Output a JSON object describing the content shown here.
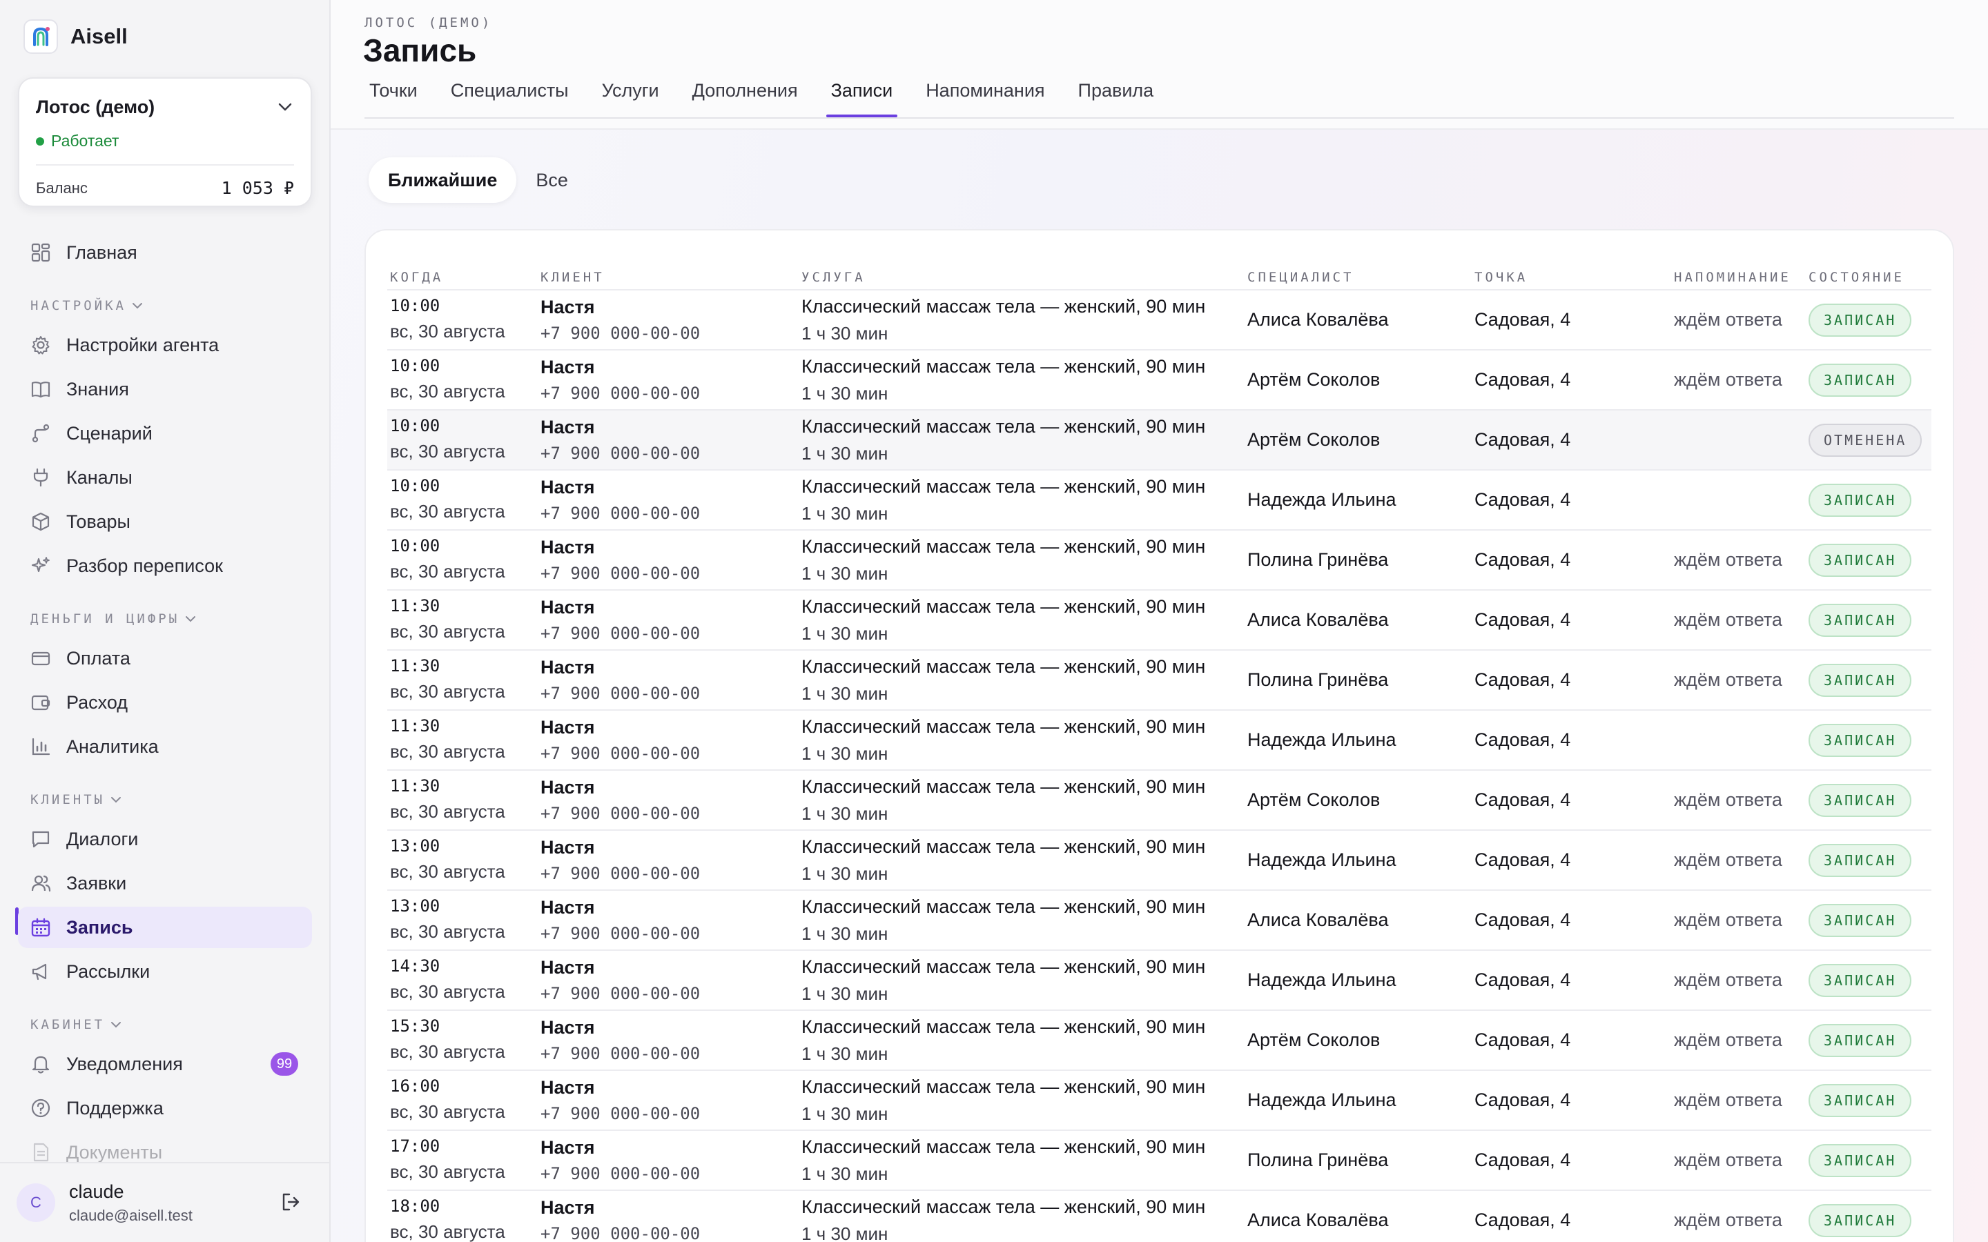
{
  "brand": {
    "name": "Aisell"
  },
  "org": {
    "name": "Лотос (демо)",
    "status": "Работает",
    "balance_label": "Баланс",
    "balance_value": "1 053 ₽"
  },
  "nav": {
    "home": "Главная",
    "section_settings": "НАСТРОЙКА",
    "agent_settings": "Настройки агента",
    "knowledge": "Знания",
    "scenario": "Сценарий",
    "channels": "Каналы",
    "products": "Товары",
    "chat_review": "Разбор переписок",
    "section_money": "ДЕНЬГИ И ЦИФРЫ",
    "payment": "Оплата",
    "expense": "Расход",
    "analytics": "Аналитика",
    "section_clients": "КЛИЕНТЫ",
    "dialogs": "Диалоги",
    "requests": "Заявки",
    "booking": "Запись",
    "mailings": "Рассылки",
    "section_cabinet": "КАБИНЕТ",
    "notifications": "Уведомления",
    "notifications_count": "99",
    "support": "Поддержка",
    "documents": "Документы"
  },
  "user": {
    "initial": "C",
    "name": "claude",
    "email": "claude@aisell.test"
  },
  "header": {
    "kicker": "ЛОТОС (ДЕМО)",
    "title": "Запись",
    "tabs": [
      "Точки",
      "Специалисты",
      "Услуги",
      "Дополнения",
      "Записи",
      "Напоминания",
      "Правила"
    ],
    "active_tab": "Записи"
  },
  "filter": {
    "nearest": "Ближайшие",
    "all": "Все"
  },
  "table": {
    "columns": [
      "КОГДА",
      "КЛИЕНТ",
      "УСЛУГА",
      "СПЕЦИАЛИСТ",
      "ТОЧКА",
      "НАПОМИНАНИЕ",
      "СОСТОЯНИЕ"
    ],
    "rows": [
      {
        "time": "10:00",
        "date": "вс, 30 августа",
        "client": "Настя",
        "phone": "+7 900 000-00-00",
        "service": "Классический массаж тела — женский, 90 мин",
        "duration": "1 ч 30 мин",
        "specialist": "Алиса Ковалёва",
        "location": "Садовая, 4",
        "reminder": "ждём ответа",
        "status": "ЗАПИСАН"
      },
      {
        "time": "10:00",
        "date": "вс, 30 августа",
        "client": "Настя",
        "phone": "+7 900 000-00-00",
        "service": "Классический массаж тела — женский, 90 мин",
        "duration": "1 ч 30 мин",
        "specialist": "Артём Соколов",
        "location": "Садовая, 4",
        "reminder": "ждём ответа",
        "status": "ЗАПИСАН"
      },
      {
        "time": "10:00",
        "date": "вс, 30 августа",
        "client": "Настя",
        "phone": "+7 900 000-00-00",
        "service": "Классический массаж тела — женский, 90 мин",
        "duration": "1 ч 30 мин",
        "specialist": "Артём Соколов",
        "location": "Садовая, 4",
        "reminder": "",
        "status": "ОТМЕНЕНА"
      },
      {
        "time": "10:00",
        "date": "вс, 30 августа",
        "client": "Настя",
        "phone": "+7 900 000-00-00",
        "service": "Классический массаж тела — женский, 90 мин",
        "duration": "1 ч 30 мин",
        "specialist": "Надежда Ильина",
        "location": "Садовая, 4",
        "reminder": "",
        "status": "ЗАПИСАН"
      },
      {
        "time": "10:00",
        "date": "вс, 30 августа",
        "client": "Настя",
        "phone": "+7 900 000-00-00",
        "service": "Классический массаж тела — женский, 90 мин",
        "duration": "1 ч 30 мин",
        "specialist": "Полина Гринёва",
        "location": "Садовая, 4",
        "reminder": "ждём ответа",
        "status": "ЗАПИСАН"
      },
      {
        "time": "11:30",
        "date": "вс, 30 августа",
        "client": "Настя",
        "phone": "+7 900 000-00-00",
        "service": "Классический массаж тела — женский, 90 мин",
        "duration": "1 ч 30 мин",
        "specialist": "Алиса Ковалёва",
        "location": "Садовая, 4",
        "reminder": "ждём ответа",
        "status": "ЗАПИСАН"
      },
      {
        "time": "11:30",
        "date": "вс, 30 августа",
        "client": "Настя",
        "phone": "+7 900 000-00-00",
        "service": "Классический массаж тела — женский, 90 мин",
        "duration": "1 ч 30 мин",
        "specialist": "Полина Гринёва",
        "location": "Садовая, 4",
        "reminder": "ждём ответа",
        "status": "ЗАПИСАН"
      },
      {
        "time": "11:30",
        "date": "вс, 30 августа",
        "client": "Настя",
        "phone": "+7 900 000-00-00",
        "service": "Классический массаж тела — женский, 90 мин",
        "duration": "1 ч 30 мин",
        "specialist": "Надежда Ильина",
        "location": "Садовая, 4",
        "reminder": "",
        "status": "ЗАПИСАН"
      },
      {
        "time": "11:30",
        "date": "вс, 30 августа",
        "client": "Настя",
        "phone": "+7 900 000-00-00",
        "service": "Классический массаж тела — женский, 90 мин",
        "duration": "1 ч 30 мин",
        "specialist": "Артём Соколов",
        "location": "Садовая, 4",
        "reminder": "ждём ответа",
        "status": "ЗАПИСАН"
      },
      {
        "time": "13:00",
        "date": "вс, 30 августа",
        "client": "Настя",
        "phone": "+7 900 000-00-00",
        "service": "Классический массаж тела — женский, 90 мин",
        "duration": "1 ч 30 мин",
        "specialist": "Надежда Ильина",
        "location": "Садовая, 4",
        "reminder": "ждём ответа",
        "status": "ЗАПИСАН"
      },
      {
        "time": "13:00",
        "date": "вс, 30 августа",
        "client": "Настя",
        "phone": "+7 900 000-00-00",
        "service": "Классический массаж тела — женский, 90 мин",
        "duration": "1 ч 30 мин",
        "specialist": "Алиса Ковалёва",
        "location": "Садовая, 4",
        "reminder": "ждём ответа",
        "status": "ЗАПИСАН"
      },
      {
        "time": "14:30",
        "date": "вс, 30 августа",
        "client": "Настя",
        "phone": "+7 900 000-00-00",
        "service": "Классический массаж тела — женский, 90 мин",
        "duration": "1 ч 30 мин",
        "specialist": "Надежда Ильина",
        "location": "Садовая, 4",
        "reminder": "ждём ответа",
        "status": "ЗАПИСАН"
      },
      {
        "time": "15:30",
        "date": "вс, 30 августа",
        "client": "Настя",
        "phone": "+7 900 000-00-00",
        "service": "Классический массаж тела — женский, 90 мин",
        "duration": "1 ч 30 мин",
        "specialist": "Артём Соколов",
        "location": "Садовая, 4",
        "reminder": "ждём ответа",
        "status": "ЗАПИСАН"
      },
      {
        "time": "16:00",
        "date": "вс, 30 августа",
        "client": "Настя",
        "phone": "+7 900 000-00-00",
        "service": "Классический массаж тела — женский, 90 мин",
        "duration": "1 ч 30 мин",
        "specialist": "Надежда Ильина",
        "location": "Садовая, 4",
        "reminder": "ждём ответа",
        "status": "ЗАПИСАН"
      },
      {
        "time": "17:00",
        "date": "вс, 30 августа",
        "client": "Настя",
        "phone": "+7 900 000-00-00",
        "service": "Классический массаж тела — женский, 90 мин",
        "duration": "1 ч 30 мин",
        "specialist": "Полина Гринёва",
        "location": "Садовая, 4",
        "reminder": "ждём ответа",
        "status": "ЗАПИСАН"
      },
      {
        "time": "18:00",
        "date": "вс, 30 августа",
        "client": "Настя",
        "phone": "+7 900 000-00-00",
        "service": "Классический массаж тела — женский, 90 мин",
        "duration": "1 ч 30 мин",
        "specialist": "Алиса Ковалёва",
        "location": "Садовая, 4",
        "reminder": "ждём ответа",
        "status": "ЗАПИСАН"
      }
    ]
  },
  "colors": {
    "accent": "#6b3fe0",
    "status_ok": "#1f7a3a",
    "status_ok_bg": "#e7f6ea",
    "status_cancel": "#55555f",
    "working": "#1b8a3a",
    "badge": "#9a55e8"
  }
}
